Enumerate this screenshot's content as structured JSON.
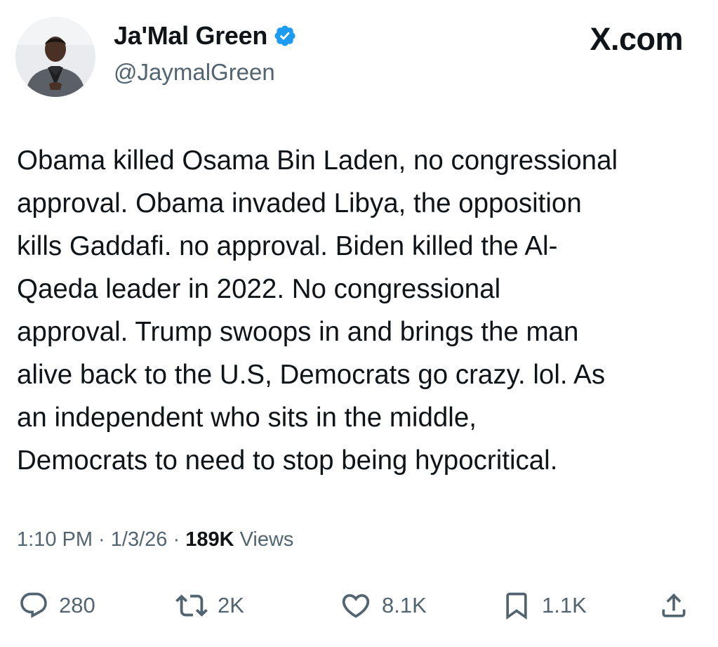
{
  "author": {
    "display_name": "Ja'Mal Green",
    "handle": "@JaymalGreen",
    "verified": true,
    "verified_color": "#1d9bf0"
  },
  "brand": "X.com",
  "tweet": {
    "text": "Obama killed Osama Bin Laden, no congressional\napproval. Obama invaded Libya, the opposition\nkills Gaddafi. no approval. Biden killed the Al-\nQaeda leader in 2022. No congressional\napproval. Trump swoops in and brings the man\nalive back to the U.S, Democrats go crazy. lol. As\nan independent who sits in the middle,\nDemocrats to need to stop being hypocritical."
  },
  "meta": {
    "time": "1:10 PM",
    "sep1": " · ",
    "date": "1/3/26",
    "sep2": " · ",
    "views_count": "189K",
    "views_label": " Views"
  },
  "actions": [
    {
      "icon": "reply-icon",
      "count": "280"
    },
    {
      "icon": "retweet-icon",
      "count": "2K"
    },
    {
      "icon": "like-icon",
      "count": "8.1K"
    },
    {
      "icon": "bookmark-icon",
      "count": "1.1K"
    },
    {
      "icon": "share-icon",
      "count": ""
    }
  ],
  "colors": {
    "text_primary": "#0f1419",
    "text_secondary": "#536471",
    "icon": "#536471"
  }
}
